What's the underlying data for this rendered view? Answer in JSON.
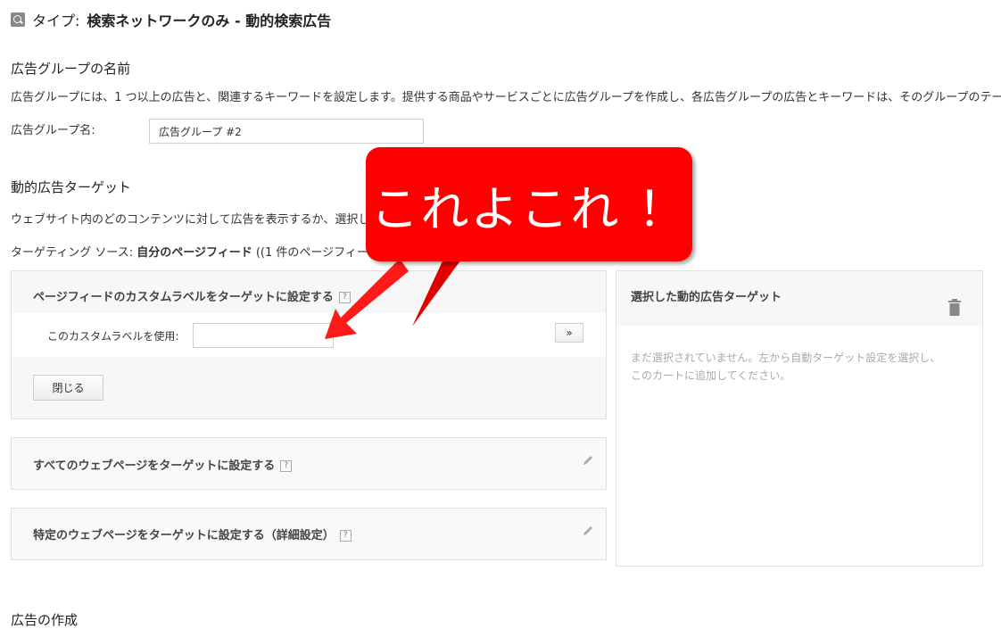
{
  "header": {
    "type_label": "タイプ:",
    "type_value": "検索ネットワークのみ - 動的検索広告"
  },
  "ad_group": {
    "title": "広告グループの名前",
    "description": "広告グループには、1 つ以上の広告と、関連するキーワードを設定します。提供する商品やサービスごとに広告グループを作成し、各広告グループの広告とキーワードは、そのグループのテー",
    "name_label": "広告グループ名:",
    "name_value": "広告グループ #2"
  },
  "dynamic_target": {
    "title": "動的広告ターゲット",
    "description": "ウェブサイト内のどのコンテンツに対して広告を表示するか、選択し",
    "source_label": "ターゲティング ソース:",
    "source_value": "自分のページフィード",
    "source_count": "((1 件のページフィー"
  },
  "page_feed_panel": {
    "title": "ページフィードのカスタムラベルをターゲットに設定する",
    "help": "?",
    "custom_label": "このカスタムラベルを使用:",
    "custom_value": "",
    "add_button": "»",
    "close_button": "閉じる"
  },
  "all_pages_panel": {
    "title": "すべてのウェブページをターゲットに設定する",
    "help": "?"
  },
  "specific_pages_panel": {
    "title": "特定のウェブページをターゲットに設定する（詳細設定）",
    "help": "?"
  },
  "selected_panel": {
    "title": "選択した動的広告ターゲット",
    "empty_line1": "まだ選択されていません。左から自動ターゲット設定を選択し、",
    "empty_line2": "このカートに追加してください。"
  },
  "ad_creation": {
    "title": "広告の作成"
  },
  "annotation": {
    "text": "これよこれ ！"
  },
  "colors": {
    "callout": "#ff0000",
    "panel_bg": "#f7f7f7",
    "border": "#e0e0e0"
  }
}
